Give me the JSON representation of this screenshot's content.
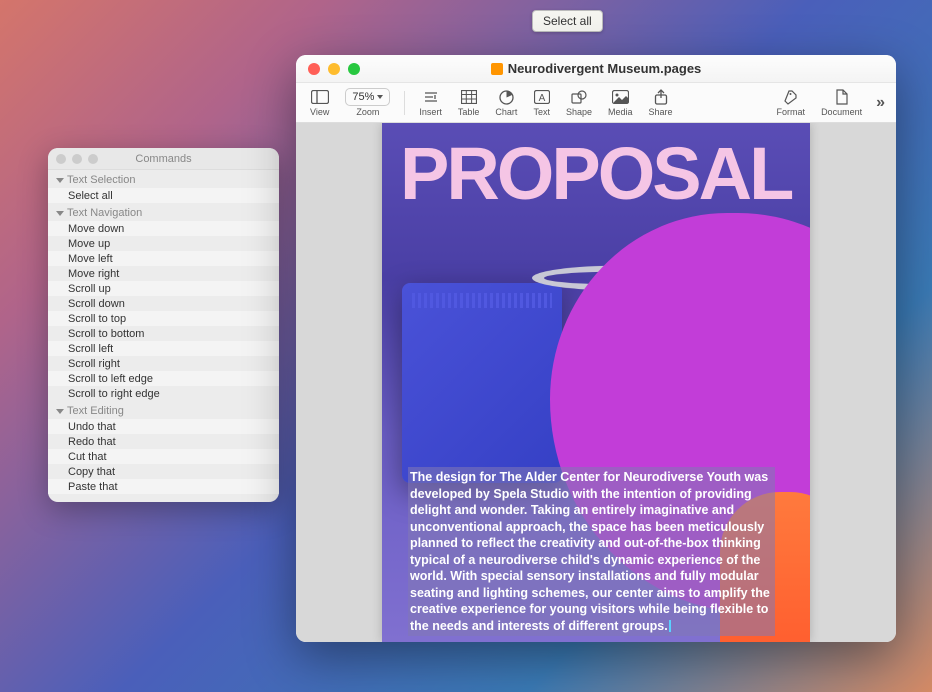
{
  "tooltip": {
    "text": "Select all"
  },
  "commands_panel": {
    "title": "Commands",
    "sections": [
      {
        "header": "Text Selection",
        "items": [
          "Select all"
        ]
      },
      {
        "header": "Text Navigation",
        "items": [
          "Move down",
          "Move up",
          "Move left",
          "Move right",
          "Scroll up",
          "Scroll down",
          "Scroll to top",
          "Scroll to bottom",
          "Scroll left",
          "Scroll right",
          "Scroll to left edge",
          "Scroll to right edge"
        ]
      },
      {
        "header": "Text Editing",
        "items": [
          "Undo that",
          "Redo that",
          "Cut that",
          "Copy that",
          "Paste that"
        ]
      }
    ]
  },
  "pages_window": {
    "title": "Neurodivergent Museum.pages",
    "toolbar": {
      "view": "View",
      "zoom_value": "75%",
      "zoom_label": "Zoom",
      "insert": "Insert",
      "table": "Table",
      "chart": "Chart",
      "text": "Text",
      "shape": "Shape",
      "media": "Media",
      "share": "Share",
      "format": "Format",
      "document": "Document"
    },
    "document": {
      "heading": "PROPOSAL",
      "body": "The design for The Alder Center for Neurodiverse Youth was developed by Spela Studio with the intention of providing delight and wonder. Taking an entirely imaginative and unconventional approach, the space has been meticulously planned to reflect the creativity and out-of-the-box thinking typical of a neurodiverse child's dynamic experience of the world. With special sensory installations and fully modular seating and lighting schemes, our center aims to amplify the creative experience for young visitors while being flexible to the needs and interests of different groups."
    }
  }
}
